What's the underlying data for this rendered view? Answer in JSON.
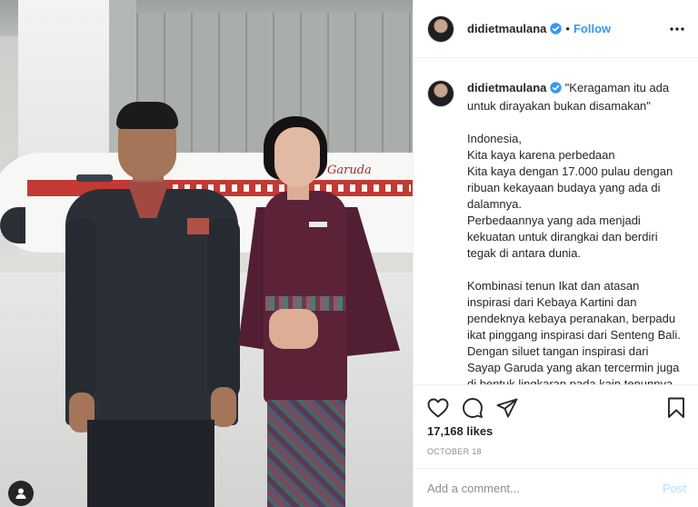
{
  "post": {
    "username": "didietmaulana",
    "follow_label": "Follow",
    "separator": "•",
    "caption_user": "didietmaulana",
    "caption_text": "\"Keragaman itu ada untuk dirayakan bukan disamakan\"\n\nIndonesia,\nKita kaya karena perbedaan\nKita kaya dengan 17.000 pulau dengan ribuan kekayaan budaya yang ada di dalamnya.\nPerbedaannya yang ada menjadi kekuatan untuk dirangkai dan berdiri tegak di antara dunia.\n\nKombinasi tenun Ikat dan atasan inspirasi dari Kebaya Kartini dan pendeknya kebaya peranakan, berpadu ikat pinggang inspirasi dari Senteng Bali. Dengan siluet tangan inspirasi dari Sayap Garuda yang akan tercermin juga di bentuk lingkaran pada kain tenunnya.",
    "likes": "17,168 likes",
    "date": "OCTOBER 18",
    "comment_placeholder": "Add a comment...",
    "post_label": "Post",
    "photo_logo_text": "Garuda"
  },
  "icons": {
    "verified": "verified-badge-icon",
    "more": "more-options-icon",
    "like": "heart-icon",
    "comment": "comment-icon",
    "share": "paper-plane-icon",
    "save": "bookmark-icon",
    "user_tag": "user-tag-icon"
  },
  "colors": {
    "accent": "#3897f0",
    "post_disabled": "#b2dffc",
    "muted": "#8e8e8e",
    "text": "#262626",
    "divider": "#efefef"
  }
}
